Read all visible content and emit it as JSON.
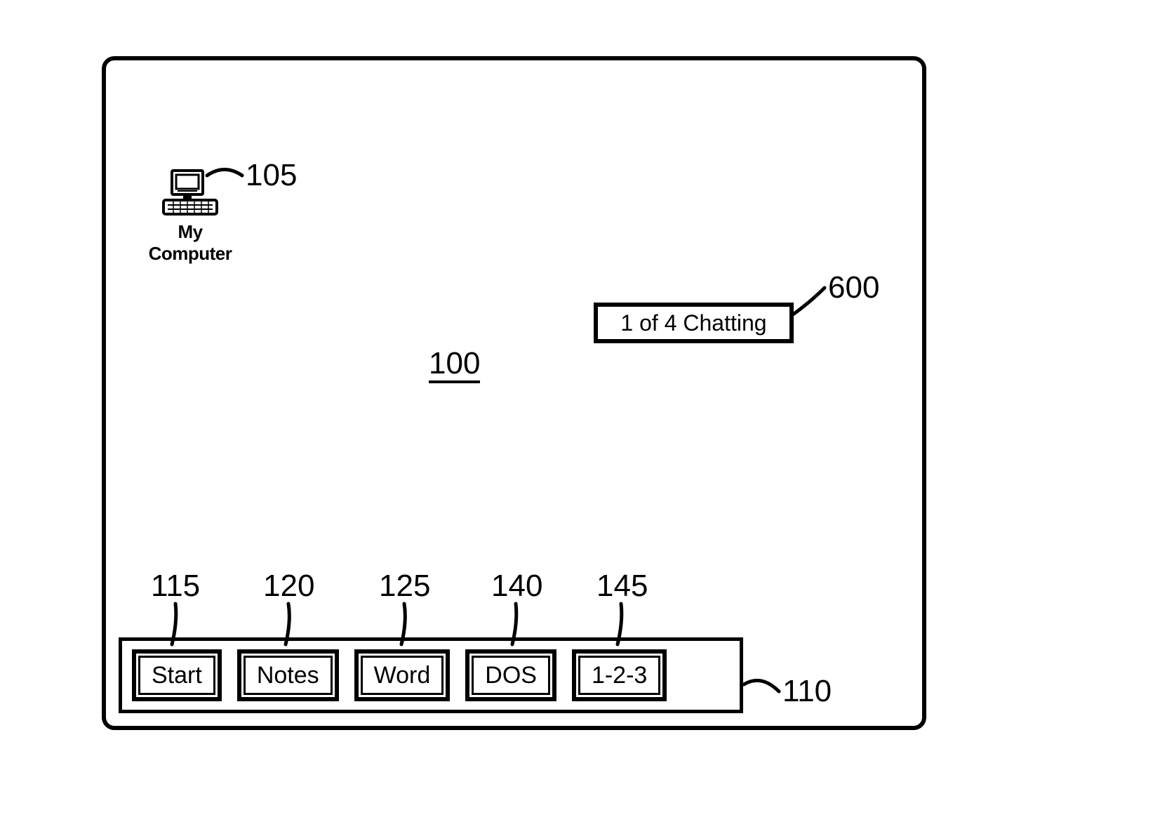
{
  "desktop": {
    "icons": [
      {
        "name": "my-computer",
        "label": "My Computer"
      }
    ]
  },
  "notification": {
    "text": "1 of 4 Chatting"
  },
  "taskbar": {
    "buttons": [
      {
        "name": "start",
        "label": "Start"
      },
      {
        "name": "notes",
        "label": "Notes"
      },
      {
        "name": "word",
        "label": "Word"
      },
      {
        "name": "dos",
        "label": "DOS"
      },
      {
        "name": "lotus",
        "label": "1-2-3"
      }
    ]
  },
  "refs": {
    "desktop": "100",
    "my_computer": "105",
    "taskbar": "110",
    "btn_start": "115",
    "btn_notes": "120",
    "btn_word": "125",
    "btn_dos": "140",
    "btn_lotus": "145",
    "notification": "600"
  }
}
